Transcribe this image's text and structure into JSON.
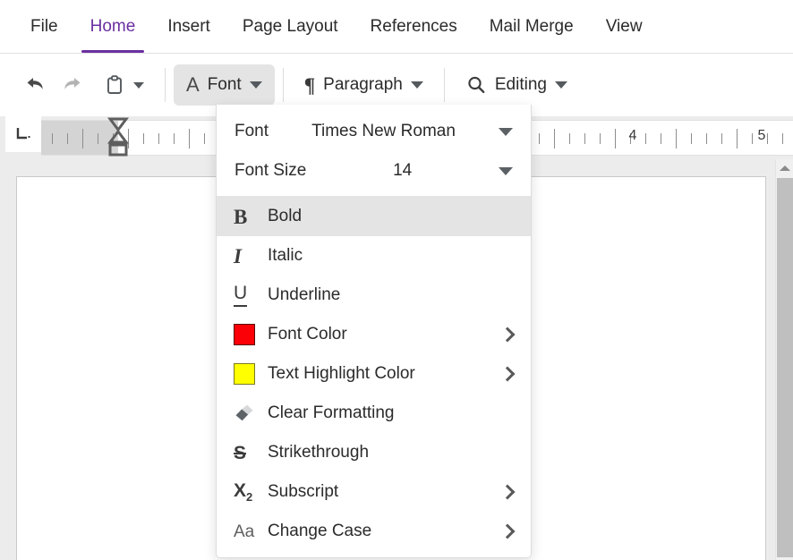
{
  "ribbon": {
    "tabs": [
      {
        "label": "File",
        "active": false
      },
      {
        "label": "Home",
        "active": true
      },
      {
        "label": "Insert",
        "active": false
      },
      {
        "label": "Page Layout",
        "active": false
      },
      {
        "label": "References",
        "active": false
      },
      {
        "label": "Mail Merge",
        "active": false
      },
      {
        "label": "View",
        "active": false
      }
    ],
    "active_tab": "Home",
    "accent_color": "#6b2fa0"
  },
  "toolbar": {
    "undo_label": "Undo",
    "redo_label": "Redo",
    "paste_label": "Paste",
    "font_label": "Font",
    "paragraph_label": "Paragraph",
    "editing_label": "Editing",
    "font_group_active": true
  },
  "ruler": {
    "numbers": [
      "4",
      "5"
    ],
    "unit": "inches"
  },
  "font_menu": {
    "open": true,
    "fields": [
      {
        "label": "Font",
        "value": "Times New Roman"
      },
      {
        "label": "Font Size",
        "value": "14"
      }
    ],
    "items": [
      {
        "label": "Bold",
        "icon": "bold-icon",
        "submenu": false,
        "highlighted": true
      },
      {
        "label": "Italic",
        "icon": "italic-icon",
        "submenu": false,
        "highlighted": false
      },
      {
        "label": "Underline",
        "icon": "underline-icon",
        "submenu": false,
        "highlighted": false
      },
      {
        "label": "Font Color",
        "icon": "font-color-swatch",
        "submenu": true,
        "highlighted": false,
        "color": "#fb0007"
      },
      {
        "label": "Text Highlight Color",
        "icon": "highlight-color-swatch",
        "submenu": true,
        "highlighted": false,
        "color": "#ffff00"
      },
      {
        "label": "Clear Formatting",
        "icon": "eraser-icon",
        "submenu": false,
        "highlighted": false
      },
      {
        "label": "Strikethrough",
        "icon": "strikethrough-icon",
        "submenu": false,
        "highlighted": false
      },
      {
        "label": "Subscript",
        "icon": "subscript-icon",
        "submenu": true,
        "highlighted": false
      },
      {
        "label": "Change Case",
        "icon": "change-case-icon",
        "submenu": true,
        "highlighted": false
      }
    ],
    "glyphs": {
      "bold": "B",
      "italic": "I",
      "underline": "U",
      "strikethrough": "S",
      "subscript_base": "X",
      "subscript_sub": "2",
      "change_case": "Aa"
    }
  },
  "document": {
    "page_background": "#ffffff",
    "canvas_background": "#ececec",
    "content": ""
  },
  "scrollbar": {
    "position": "right",
    "scroll_up_label": "Scroll up"
  }
}
